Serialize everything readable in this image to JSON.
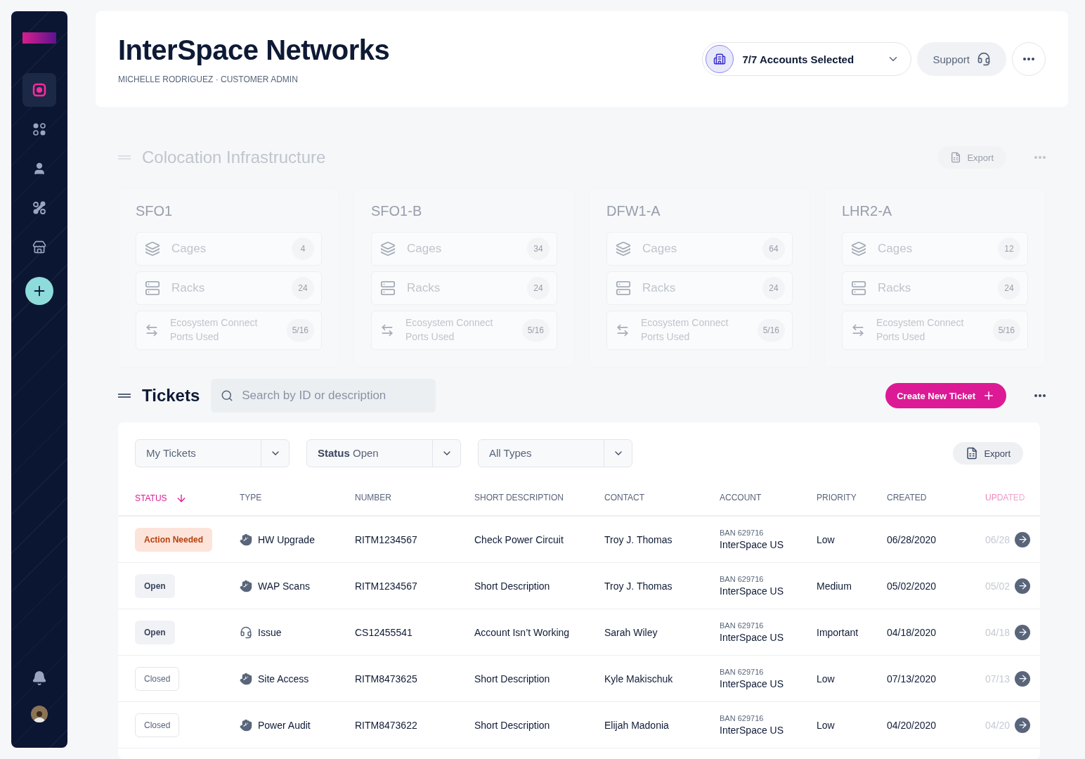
{
  "sidebar": {
    "items": [
      {
        "selected": true
      },
      {
        "selected": false
      },
      {
        "selected": false
      },
      {
        "selected": false
      },
      {
        "selected": false
      }
    ]
  },
  "header": {
    "title": "InterSpace Networks",
    "subtitle": "MICHELLE RODRIGUEZ · CUSTOMER ADMIN",
    "account_selector": "7/7 Accounts Selected",
    "support_button": "Support"
  },
  "colocation": {
    "title": "Colocation Infrastructure",
    "export_button": "Export",
    "dimmed": true,
    "sites": [
      {
        "name": "SFO1",
        "rows": [
          {
            "kind": "cages",
            "label": "Cages",
            "count": "4"
          },
          {
            "kind": "racks",
            "label": "Racks",
            "count": "24"
          },
          {
            "kind": "ports",
            "label": "Ecosystem Connect Ports Used",
            "count": "5/16"
          }
        ]
      },
      {
        "name": "SFO1-B",
        "rows": [
          {
            "kind": "cages",
            "label": "Cages",
            "count": "34"
          },
          {
            "kind": "racks",
            "label": "Racks",
            "count": "24"
          },
          {
            "kind": "ports",
            "label": "Ecosystem Connect Ports Used",
            "count": "5/16"
          }
        ]
      },
      {
        "name": "DFW1-A",
        "rows": [
          {
            "kind": "cages",
            "label": "Cages",
            "count": "64"
          },
          {
            "kind": "racks",
            "label": "Racks",
            "count": "24"
          },
          {
            "kind": "ports",
            "label": "Ecosystem Connect Ports Used",
            "count": "5/16"
          }
        ]
      },
      {
        "name": "LHR2-A",
        "rows": [
          {
            "kind": "cages",
            "label": "Cages",
            "count": "12"
          },
          {
            "kind": "racks",
            "label": "Racks",
            "count": "24"
          },
          {
            "kind": "ports",
            "label": "Ecosystem Connect Ports Used",
            "count": "5/16"
          }
        ]
      }
    ]
  },
  "tickets": {
    "title": "Tickets",
    "search": {
      "placeholder": "Search by ID or description"
    },
    "create_button": "Create New Ticket",
    "export_button": "Export",
    "filters": [
      {
        "label": "My Tickets"
      },
      {
        "label": "**Status** Open"
      },
      {
        "label": "All Types"
      }
    ],
    "columns": [
      {
        "label": "STATUS",
        "sorted": true
      },
      {
        "label": "TYPE",
        "sorted": false
      },
      {
        "label": "NUMBER",
        "sorted": false
      },
      {
        "label": "SHORT DESCRIPTION",
        "sorted": false
      },
      {
        "label": "CONTACT",
        "sorted": false
      },
      {
        "label": "ACCOUNT",
        "sorted": false
      },
      {
        "label": "PRIORITY",
        "sorted": false
      },
      {
        "label": "CREATED",
        "sorted": false
      },
      {
        "label": "UPDATED",
        "sorted": false
      }
    ],
    "rows": [
      {
        "status": {
          "label": "Action Needed",
          "kind": "action"
        },
        "type": {
          "label": "HW Upgrade",
          "kind": "hand"
        },
        "number": "RITM1234567",
        "description": "Check Power Circuit",
        "contact": "Troy J. Thomas",
        "ban": "BAN 629716",
        "account": "InterSpace US",
        "priority": "Low",
        "created": "06/28/2020",
        "updated": "06/28"
      },
      {
        "status": {
          "label": "Open",
          "kind": "open"
        },
        "type": {
          "label": "WAP Scans",
          "kind": "hand"
        },
        "number": "RITM1234567",
        "description": "Short Description",
        "contact": "Troy J. Thomas",
        "ban": "BAN 629716",
        "account": "InterSpace US",
        "priority": "Medium",
        "created": "05/02/2020",
        "updated": "05/02"
      },
      {
        "status": {
          "label": "Open",
          "kind": "open"
        },
        "type": {
          "label": "Issue",
          "kind": "support"
        },
        "number": "CS12455541",
        "description": "Account Isn’t Working",
        "contact": "Sarah Wiley",
        "ban": "BAN 629716",
        "account": "InterSpace US",
        "priority": "Important",
        "created": "04/18/2020",
        "updated": "04/18"
      },
      {
        "status": {
          "label": "Closed",
          "kind": "closed"
        },
        "type": {
          "label": "Site Access",
          "kind": "hand"
        },
        "number": "RITM8473625",
        "description": "Short Description",
        "contact": "Kyle Makischuk",
        "ban": "BAN 629716",
        "account": "InterSpace US",
        "priority": "Low",
        "created": "07/13/2020",
        "updated": "07/13"
      },
      {
        "status": {
          "label": "Closed",
          "kind": "closed"
        },
        "type": {
          "label": "Power Audit",
          "kind": "hand"
        },
        "number": "RITM8473622",
        "description": "Short Description",
        "contact": "Elijah Madonia",
        "ban": "BAN 629716",
        "account": "InterSpace US",
        "priority": "Low",
        "created": "04/20/2020",
        "updated": "04/20"
      }
    ]
  }
}
